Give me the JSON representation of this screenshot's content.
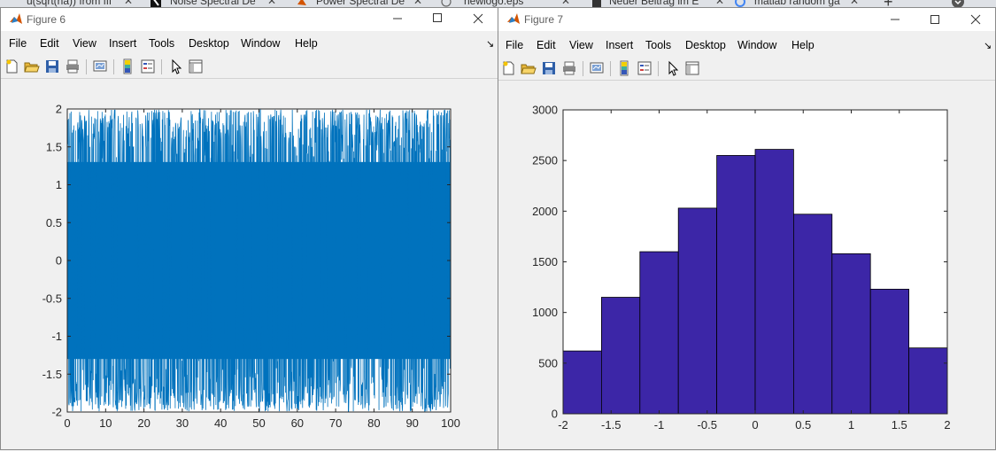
{
  "browser_tabs": [
    {
      "label": "u(sqrt(ha)) from ffi"
    },
    {
      "label": "Noise Spectral De"
    },
    {
      "label": "Power Spectral De"
    },
    {
      "label": "newlogo.eps"
    },
    {
      "label": "Neuer Beitrag im E"
    },
    {
      "label": "matlab random ga"
    }
  ],
  "menu_items": [
    "File",
    "Edit",
    "View",
    "Insert",
    "Tools",
    "Desktop",
    "Window",
    "Help"
  ],
  "toolbar_icons": [
    "new-figure-icon",
    "open-file-icon",
    "save-icon",
    "print-icon",
    "link-plot-icon",
    "insert-colorbar-icon",
    "insert-legend-icon",
    "edit-plot-icon",
    "property-inspector-icon"
  ],
  "colors": {
    "noise_line": "#0072bd",
    "histogram_bar": "#3c26a7",
    "plot_bg": "#ffffff",
    "window_bg": "#f0f0f0"
  },
  "figure6": {
    "title": "Figure 6",
    "chart_data": {
      "type": "line",
      "title": "",
      "xlabel": "",
      "ylabel": "",
      "xlim": [
        0,
        100
      ],
      "ylim": [
        -2,
        2
      ],
      "x_ticks": [
        "0",
        "10",
        "20",
        "30",
        "40",
        "50",
        "60",
        "70",
        "80",
        "90",
        "100"
      ],
      "y_ticks": [
        "2",
        "1.5",
        "1",
        "0.5",
        "0",
        "-0.5",
        "-1",
        "-1.5",
        "-2"
      ],
      "series": [
        {
          "description": "dense uniform random noise filling approximately [-2, 2] over x = 0..100",
          "envelope": [
            -2,
            2
          ]
        }
      ],
      "grid": false
    }
  },
  "figure7": {
    "title": "Figure 7",
    "chart_data": {
      "type": "bar",
      "title": "",
      "xlabel": "",
      "ylabel": "",
      "xlim": [
        -2,
        2
      ],
      "ylim": [
        0,
        3000
      ],
      "x_ticks": [
        "-2",
        "-1.5",
        "-1",
        "-0.5",
        "0",
        "0.5",
        "1",
        "1.5",
        "2"
      ],
      "y_ticks": [
        "3000",
        "2500",
        "2000",
        "1500",
        "1000",
        "500",
        "0"
      ],
      "bin_edges": [
        -2,
        -1.6,
        -1.2,
        -0.8,
        -0.4,
        0,
        0.4,
        0.8,
        1.2,
        1.6,
        2
      ],
      "values": [
        620,
        1150,
        1600,
        2030,
        2550,
        2610,
        1970,
        1580,
        1230,
        650
      ],
      "grid": false
    }
  }
}
